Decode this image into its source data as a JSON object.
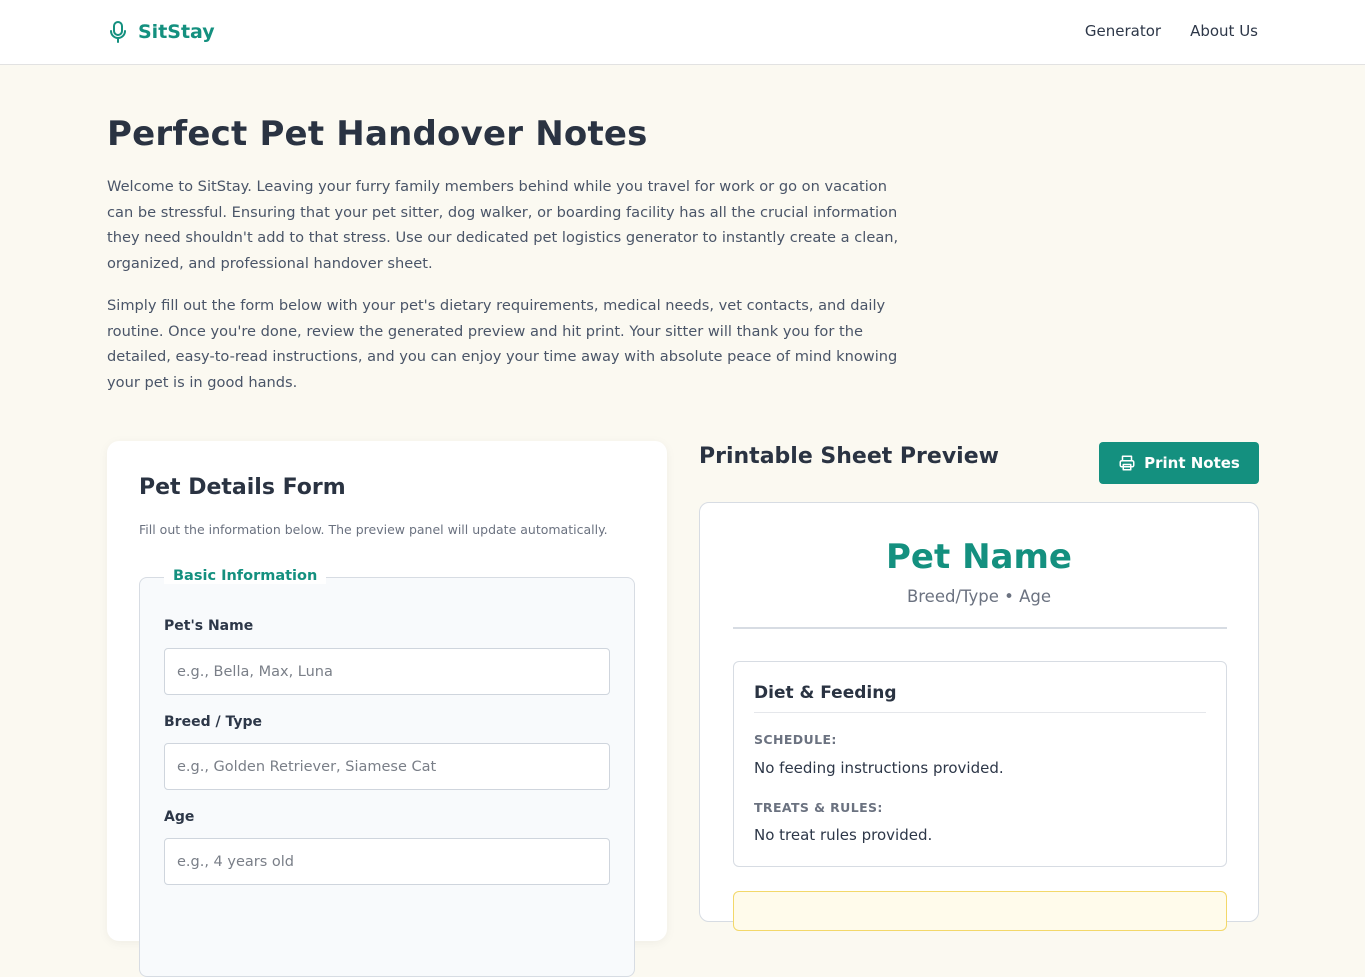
{
  "header": {
    "brand": "SitStay",
    "nav": [
      "Generator",
      "About Us"
    ]
  },
  "intro": {
    "title": "Perfect Pet Handover Notes",
    "p1": "Welcome to SitStay. Leaving your furry family members behind while you travel for work or go on vacation can be stressful. Ensuring that your pet sitter, dog walker, or boarding facility has all the crucial information they need shouldn't add to that stress. Use our dedicated pet logistics generator to instantly create a clean, organized, and professional handover sheet.",
    "p2": "Simply fill out the form below with your pet's dietary requirements, medical needs, vet contacts, and daily routine. Once you're done, review the generated preview and hit print. Your sitter will thank you for the detailed, easy-to-read instructions, and you can enjoy your time away with absolute peace of mind knowing your pet is in good hands."
  },
  "form": {
    "title": "Pet Details Form",
    "help": "Fill out the information below. The preview panel will update automatically.",
    "legend": "Basic Information",
    "fields": [
      {
        "label": "Pet's Name",
        "placeholder": "e.g., Bella, Max, Luna"
      },
      {
        "label": "Breed / Type",
        "placeholder": "e.g., Golden Retriever, Siamese Cat"
      },
      {
        "label": "Age",
        "placeholder": "e.g., 4 years old"
      }
    ]
  },
  "preview": {
    "title": "Printable Sheet Preview",
    "print_label": "Print Notes",
    "pet_name": "Pet Name",
    "subtitle": "Breed/Type • Age",
    "diet": {
      "title": "Diet & Feeding",
      "schedule_label": "SCHEDULE:",
      "schedule_value": "No feeding instructions provided.",
      "treats_label": "TREATS & RULES:",
      "treats_value": "No treat rules provided."
    }
  },
  "colors": {
    "accent": "#14907f",
    "background": "#fbf9f1"
  }
}
